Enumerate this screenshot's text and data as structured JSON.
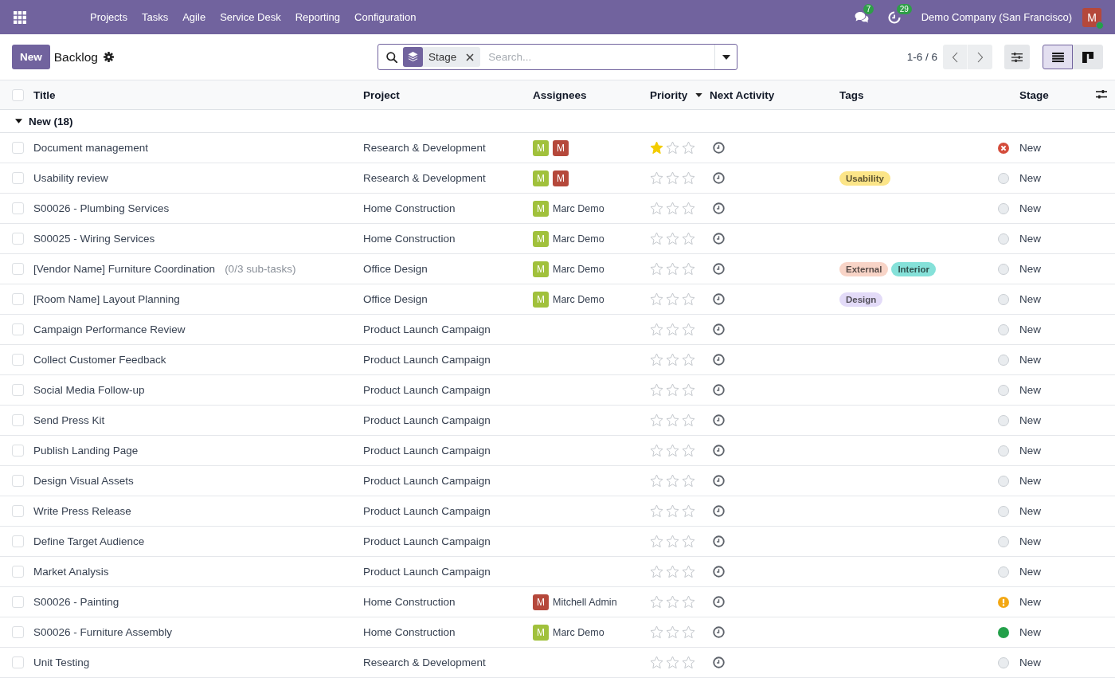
{
  "navbar": {
    "menu": [
      {
        "label": "Projects"
      },
      {
        "label": "Tasks"
      },
      {
        "label": "Agile"
      },
      {
        "label": "Service Desk"
      },
      {
        "label": "Reporting"
      },
      {
        "label": "Configuration"
      }
    ],
    "messages_badge": "7",
    "activities_badge": "29",
    "company": "Demo Company (San Francisco)",
    "user": {
      "initial": "M",
      "color": "#b5483b",
      "online": true
    }
  },
  "control_panel": {
    "new_button": "New",
    "breadcrumb": "Backlog",
    "search": {
      "facets": [
        {
          "label": "Stage"
        }
      ],
      "placeholder": "Search..."
    },
    "pager": "1-6 / 6",
    "views": [
      {
        "kind": "list",
        "selected": true
      },
      {
        "kind": "kanban",
        "selected": false
      }
    ]
  },
  "table": {
    "all_selected": false,
    "columns": [
      {
        "label": "Title"
      },
      {
        "label": "Project"
      },
      {
        "label": "Assignees"
      },
      {
        "label": "Priority",
        "sorted": true
      },
      {
        "label": "Next Activity"
      },
      {
        "label": "Tags"
      },
      {
        "label": "Stage"
      }
    ],
    "groups": [
      {
        "label": "New (18)",
        "expanded": true,
        "rows": [
          {
            "title": "Document management",
            "project": "Research & Development",
            "assignees": [
              {
                "initial": "M",
                "color": "#a1c13c"
              },
              {
                "initial": "M",
                "color": "#b5483b"
              }
            ],
            "stars": 1,
            "status": {
              "kind": "canceled"
            },
            "stage": "New",
            "selected": false
          },
          {
            "title": "Usability review",
            "project": "Research & Development",
            "assignees": [
              {
                "initial": "M",
                "color": "#a1c13c"
              },
              {
                "initial": "M",
                "color": "#b5483b"
              }
            ],
            "stars": 0,
            "tags": [
              {
                "label": "Usability",
                "color": "#fce588"
              }
            ],
            "status": {
              "kind": "progress"
            },
            "stage": "New",
            "selected": false
          },
          {
            "title": "S00026 - Plumbing Services",
            "project": "Home Construction",
            "assignees": [
              {
                "initial": "M",
                "color": "#a1c13c",
                "name": "Marc Demo"
              }
            ],
            "stars": 0,
            "status": {
              "kind": "progress"
            },
            "stage": "New",
            "selected": false
          },
          {
            "title": "S00025 - Wiring Services",
            "project": "Home Construction",
            "assignees": [
              {
                "initial": "M",
                "color": "#a1c13c",
                "name": "Marc Demo"
              }
            ],
            "stars": 0,
            "status": {
              "kind": "progress"
            },
            "stage": "New",
            "selected": false
          },
          {
            "title": "[Vendor Name] Furniture Coordination",
            "subtasks": "(0/3 sub-tasks)",
            "project": "Office Design",
            "assignees": [
              {
                "initial": "M",
                "color": "#a1c13c",
                "name": "Marc Demo"
              }
            ],
            "stars": 0,
            "tags": [
              {
                "label": "External",
                "color": "#f8d4c7"
              },
              {
                "label": "Interior",
                "color": "#85e1d9"
              }
            ],
            "status": {
              "kind": "progress"
            },
            "stage": "New",
            "selected": false
          },
          {
            "title": "[Room Name] Layout Planning",
            "project": "Office Design",
            "assignees": [
              {
                "initial": "M",
                "color": "#a1c13c",
                "name": "Marc Demo"
              }
            ],
            "stars": 0,
            "tags": [
              {
                "label": "Design",
                "color": "#e3dbf8"
              }
            ],
            "status": {
              "kind": "progress"
            },
            "stage": "New",
            "selected": false
          },
          {
            "title": "Campaign Performance Review",
            "project": "Product Launch Campaign",
            "stars": 0,
            "status": {
              "kind": "progress"
            },
            "stage": "New",
            "selected": false
          },
          {
            "title": "Collect Customer Feedback",
            "project": "Product Launch Campaign",
            "stars": 0,
            "status": {
              "kind": "progress"
            },
            "stage": "New",
            "selected": false
          },
          {
            "title": "Social Media Follow-up",
            "project": "Product Launch Campaign",
            "stars": 0,
            "status": {
              "kind": "progress"
            },
            "stage": "New",
            "selected": false
          },
          {
            "title": "Send Press Kit",
            "project": "Product Launch Campaign",
            "stars": 0,
            "status": {
              "kind": "progress"
            },
            "stage": "New",
            "selected": false
          },
          {
            "title": "Publish Landing Page",
            "project": "Product Launch Campaign",
            "stars": 0,
            "status": {
              "kind": "progress"
            },
            "stage": "New",
            "selected": false
          },
          {
            "title": "Design Visual Assets",
            "project": "Product Launch Campaign",
            "stars": 0,
            "status": {
              "kind": "progress"
            },
            "stage": "New",
            "selected": false
          },
          {
            "title": "Write Press Release",
            "project": "Product Launch Campaign",
            "stars": 0,
            "status": {
              "kind": "progress"
            },
            "stage": "New",
            "selected": false
          },
          {
            "title": "Define Target Audience",
            "project": "Product Launch Campaign",
            "stars": 0,
            "status": {
              "kind": "progress"
            },
            "stage": "New",
            "selected": false
          },
          {
            "title": "Market Analysis",
            "project": "Product Launch Campaign",
            "stars": 0,
            "status": {
              "kind": "progress"
            },
            "stage": "New",
            "selected": false
          },
          {
            "title": "S00026 - Painting",
            "project": "Home Construction",
            "assignees": [
              {
                "initial": "M",
                "color": "#b5483b",
                "name": "Mitchell Admin"
              }
            ],
            "stars": 0,
            "status": {
              "kind": "changes"
            },
            "stage": "New",
            "selected": false
          },
          {
            "title": "S00026 - Furniture Assembly",
            "project": "Home Construction",
            "assignees": [
              {
                "initial": "M",
                "color": "#a1c13c",
                "name": "Marc Demo"
              }
            ],
            "stars": 0,
            "status": {
              "kind": "approved"
            },
            "stage": "New",
            "selected": false
          },
          {
            "title": "Unit Testing",
            "project": "Research & Development",
            "stars": 0,
            "status": {
              "kind": "progress"
            },
            "stage": "New",
            "selected": false
          }
        ]
      }
    ]
  }
}
